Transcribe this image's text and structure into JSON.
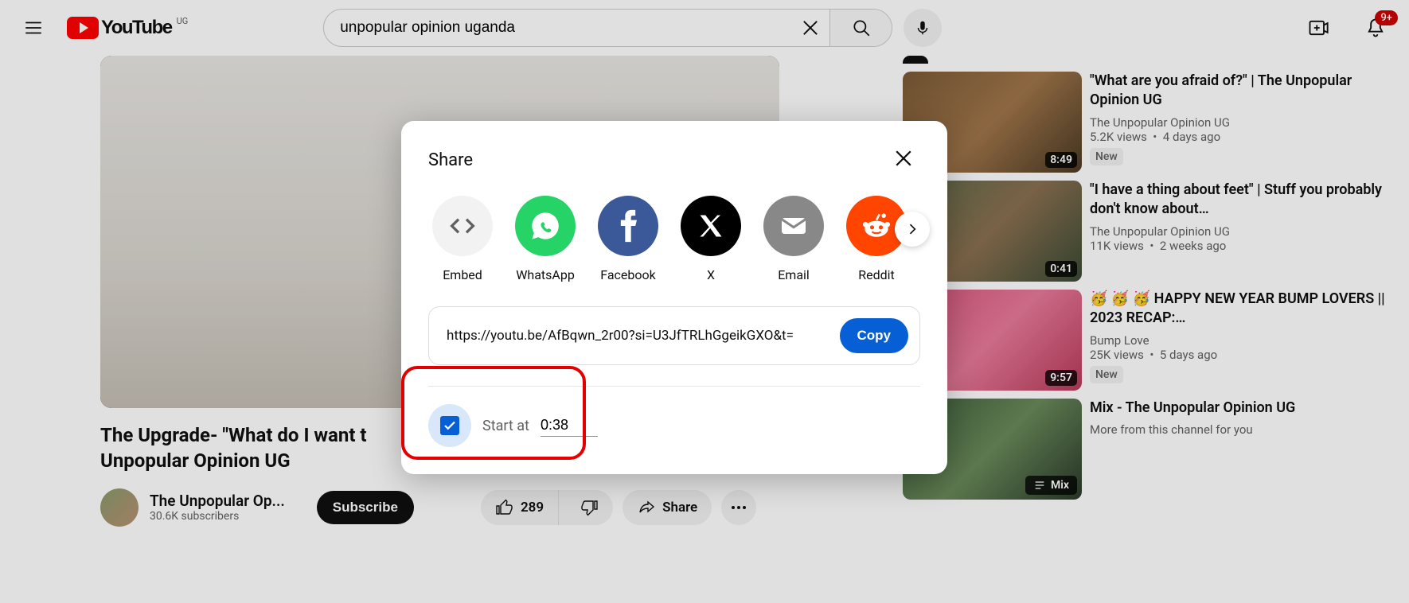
{
  "header": {
    "logo_text": "YouTube",
    "country_code": "UG",
    "search_value": "unpopular opinion uganda",
    "notification_badge": "9+"
  },
  "video": {
    "title": "The Upgrade- \"What do I want to ...\" Unpopular Opinion UG",
    "title_line1": "The Upgrade- \"What do I want t",
    "title_line2": "Unpopular Opinion UG",
    "channel_name": "The Unpopular Op...",
    "subscribers": "30.6K subscribers",
    "subscribe_label": "Subscribe",
    "likes": "289",
    "share_label": "Share"
  },
  "share_modal": {
    "title": "Share",
    "targets": [
      {
        "label": "Embed"
      },
      {
        "label": "WhatsApp"
      },
      {
        "label": "Facebook"
      },
      {
        "label": "X"
      },
      {
        "label": "Email"
      },
      {
        "label": "Reddit"
      }
    ],
    "url": "https://youtu.be/AfBqwn_2r00?si=U3JfTRLhGgeikGXO&t=",
    "copy_label": "Copy",
    "start_at_label": "Start at",
    "start_time": "0:38",
    "start_checked": true
  },
  "recommendations": [
    {
      "title": "\"What are you afraid of?\" | The Unpopular Opinion UG",
      "channel": "The Unpopular Opinion UG",
      "views": "5.2K views",
      "age": "4 days ago",
      "duration": "8:49",
      "badge": "New"
    },
    {
      "title": "\"I have a thing about feet\" | Stuff you probably don't know about…",
      "channel": "The Unpopular Opinion UG",
      "views": "11K views",
      "age": "2 weeks ago",
      "duration": "0:41"
    },
    {
      "title": "🥳 🥳 🥳  HAPPY NEW YEAR BUMP LOVERS || 2023 RECAP:…",
      "channel": "Bump Love",
      "views": "25K views",
      "age": "5 days ago",
      "duration": "9:57",
      "badge": "New"
    },
    {
      "title": "Mix - The Unpopular Opinion UG",
      "subtitle": "More from this channel for you",
      "mix": true,
      "mix_label": "Mix"
    }
  ]
}
